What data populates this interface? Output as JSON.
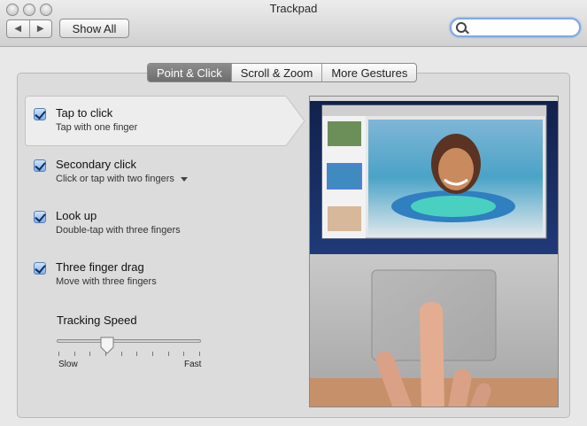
{
  "window": {
    "title": "Trackpad"
  },
  "toolbar": {
    "back": "◀",
    "forward": "▶",
    "show_all": "Show All"
  },
  "search": {
    "value": "",
    "placeholder": ""
  },
  "tabs": [
    {
      "label": "Point & Click",
      "active": true
    },
    {
      "label": "Scroll & Zoom",
      "active": false
    },
    {
      "label": "More Gestures",
      "active": false
    }
  ],
  "options": [
    {
      "title": "Tap to click",
      "subtitle": "Tap with one finger",
      "checked": true,
      "selected": true
    },
    {
      "title": "Secondary click",
      "subtitle": "Click or tap with two fingers",
      "checked": true,
      "has_menu": true
    },
    {
      "title": "Look up",
      "subtitle": "Double-tap with three fingers",
      "checked": true
    },
    {
      "title": "Three finger drag",
      "subtitle": "Move with three fingers",
      "checked": true
    }
  ],
  "tracking": {
    "label": "Tracking Speed",
    "min_label": "Slow",
    "max_label": "Fast",
    "value_fraction": 0.35
  },
  "colors": {
    "accent": "#7fa9e0",
    "tab_active": "#7a7a7a",
    "checkbox": "#7fb0ec"
  }
}
